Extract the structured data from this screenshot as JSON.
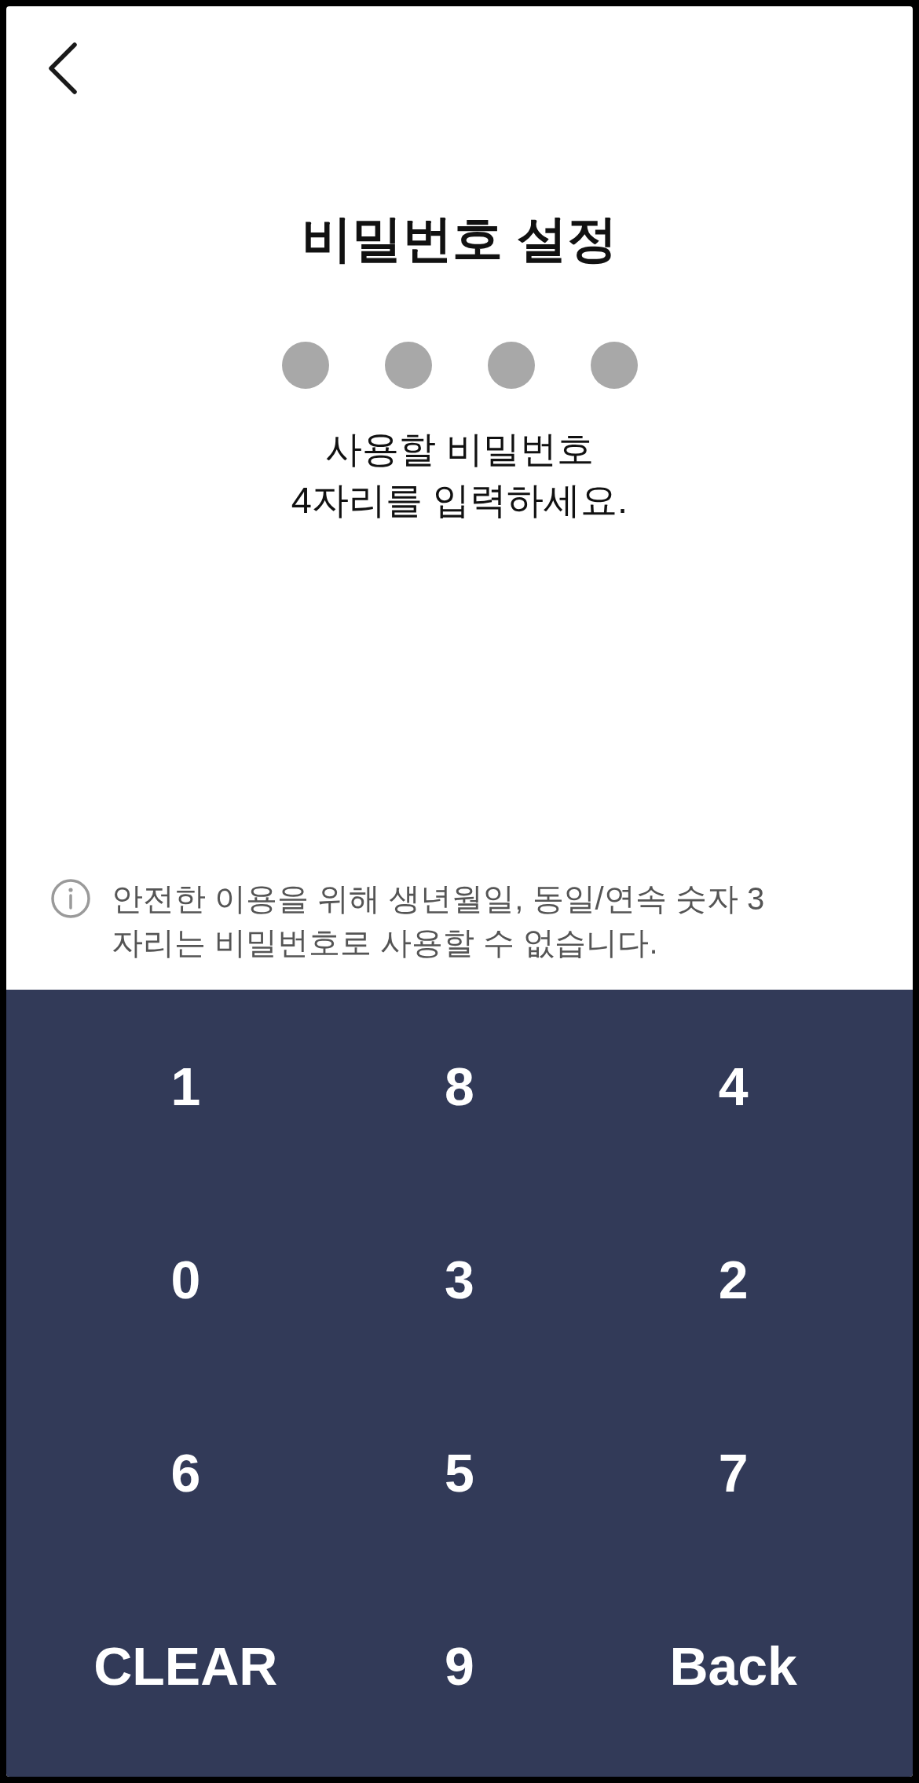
{
  "title": "비밀번호 설정",
  "pin_dots": [
    {
      "filled": false
    },
    {
      "filled": false
    },
    {
      "filled": false
    },
    {
      "filled": false
    }
  ],
  "instruction": {
    "lines": [
      "사용할 비밀번호",
      "4자리를 입력하세요."
    ]
  },
  "notice": {
    "lines": [
      "안전한 이용을 위해 생년월일, 동일/연속 숫자 3",
      "자리는 비밀번호로 사용할 수 없습니다."
    ]
  },
  "keypad": {
    "keys": [
      "1",
      "8",
      "4",
      "0",
      "3",
      "2",
      "6",
      "5",
      "7",
      "CLEAR",
      "9",
      "Back"
    ]
  }
}
